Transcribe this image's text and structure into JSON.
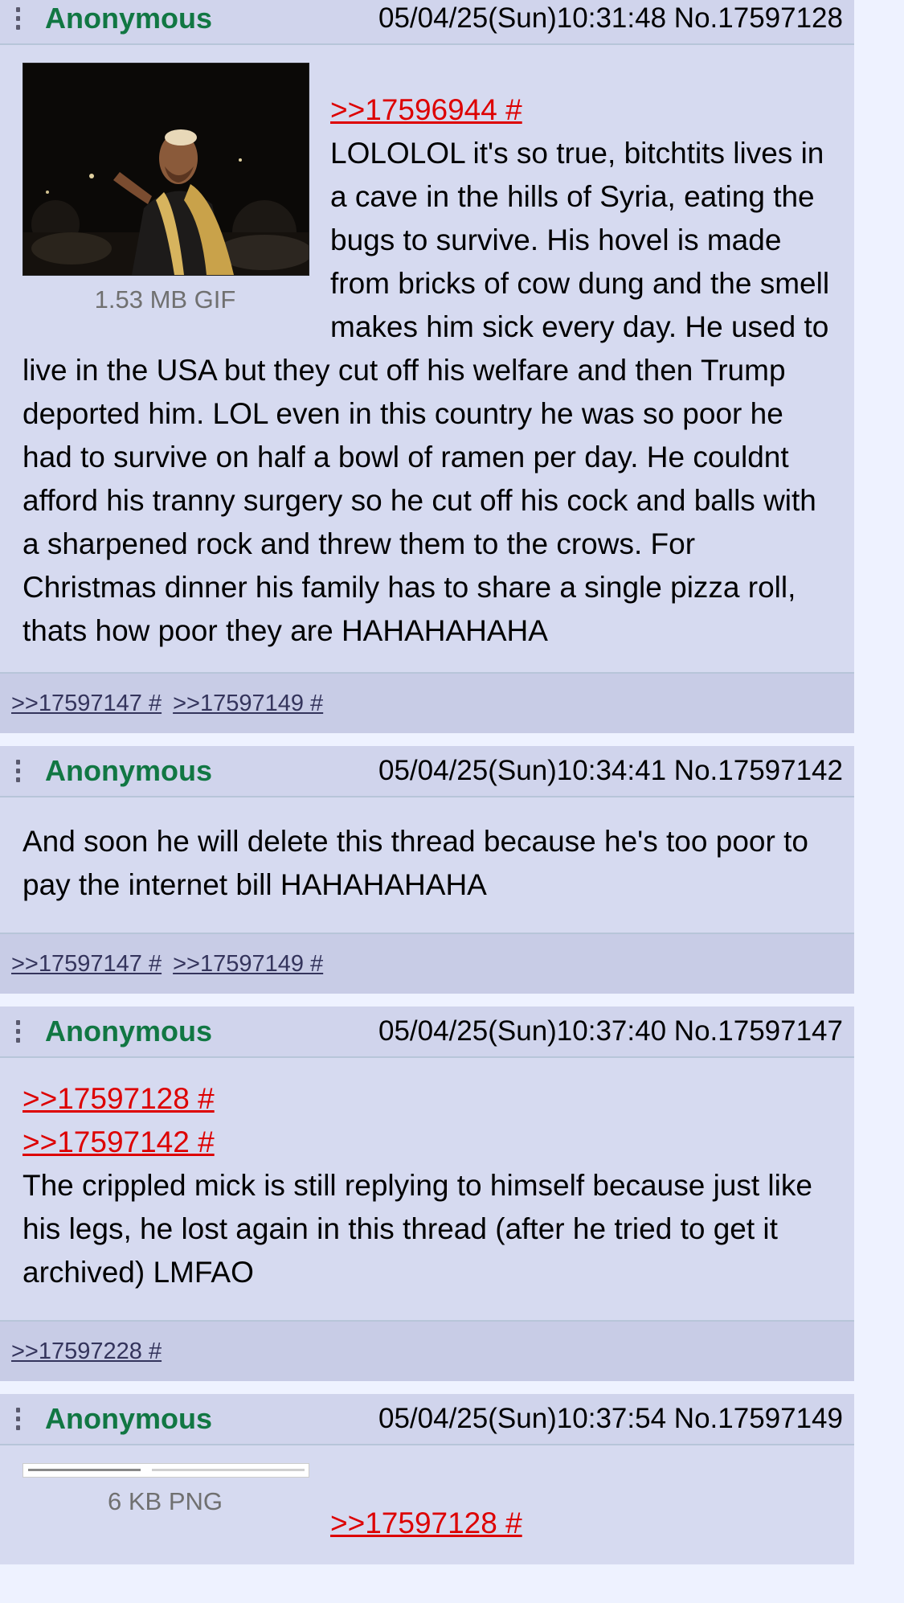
{
  "posts": [
    {
      "name": "Anonymous",
      "datetime": "05/04/25(Sun)10:31:48",
      "number": "No.17597128",
      "file_info": "1.53 MB GIF",
      "quote_links": [
        ">>17596944 #"
      ],
      "text": "LOLOLOL it's so true, bitchtits lives in a cave in the hills of Syria, eating the bugs to survive. His hovel is made from bricks of cow dung and the smell makes him sick every day. He used to live in the USA but they cut off his welfare and then Trump deported him. LOL even in this country he was so poor he had to survive on half a bowl of ramen per day. He couldnt afford his tranny surgery so he cut off his cock and balls with a sharpened rock and threw them to the crows. For Christmas dinner his family has to share a single pizza roll, thats how poor they are HAHAHAHAHA",
      "backlinks": [
        ">>17597147 #",
        ">>17597149 #"
      ]
    },
    {
      "name": "Anonymous",
      "datetime": "05/04/25(Sun)10:34:41",
      "number": "No.17597142",
      "text": "And soon he will delete this thread because he's too poor to pay the internet bill HAHAHAHAHA",
      "backlinks": [
        ">>17597147 #",
        ">>17597149 #"
      ]
    },
    {
      "name": "Anonymous",
      "datetime": "05/04/25(Sun)10:37:40",
      "number": "No.17597147",
      "quote_links": [
        ">>17597128 #",
        ">>17597142 #"
      ],
      "text": "The crippled mick is still replying to himself because just like his legs, he lost again in this thread (after he tried to get it archived) LMFAO",
      "backlinks": [
        ">>17597228 #"
      ]
    },
    {
      "name": "Anonymous",
      "datetime": "05/04/25(Sun)10:37:54",
      "number": "No.17597149",
      "file_info": "6 KB PNG",
      "quote_links": [
        ">>17597128 #"
      ]
    }
  ],
  "colors": {
    "page_bg": "#eef2ff",
    "post_bg": "#d6daf0",
    "name": "#117743",
    "quote_link": "#dd0000",
    "backlink": "#34345c"
  }
}
